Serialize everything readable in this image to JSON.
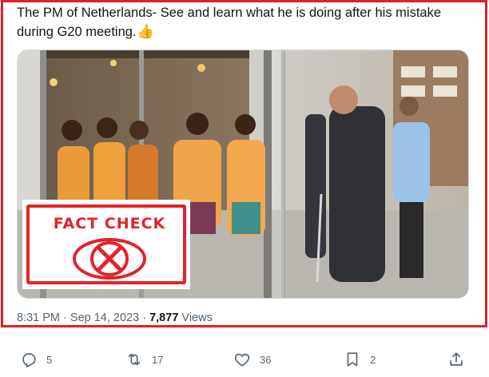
{
  "tweet": {
    "text_line1": "The PM of Netherlands- See and learn what he is doing after his mistake",
    "text_line2": "during G20 meeting.",
    "emoji": "👍",
    "time": "8:31 PM",
    "separator": "·",
    "date": "Sep 14, 2023",
    "views_count": "7,877",
    "views_label": "Views"
  },
  "stamp": {
    "text": "FACT CHECK",
    "color": "#e2232a"
  },
  "actions": {
    "reply": {
      "icon": "reply-icon",
      "count": "5"
    },
    "retweet": {
      "icon": "retweet-icon",
      "count": "17"
    },
    "like": {
      "icon": "heart-icon",
      "count": "36"
    },
    "bookmark": {
      "icon": "bookmark-icon",
      "count": "2"
    },
    "share": {
      "icon": "share-icon"
    }
  },
  "colors": {
    "highlight_border": "#e0202a",
    "secondary_text": "#536471",
    "primary_text": "#0f1419"
  }
}
